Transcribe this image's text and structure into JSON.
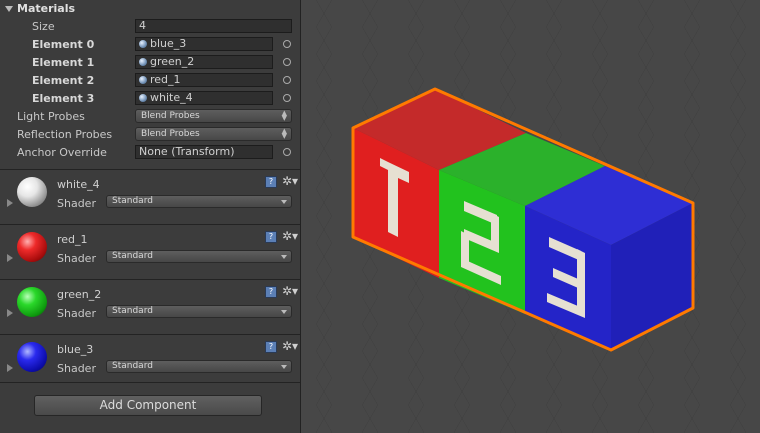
{
  "materials": {
    "header": "Materials",
    "size_label": "Size",
    "size_value": "4",
    "elements": [
      {
        "label": "Element 0",
        "value": "blue_3"
      },
      {
        "label": "Element 1",
        "value": "green_2"
      },
      {
        "label": "Element 2",
        "value": "red_1"
      },
      {
        "label": "Element 3",
        "value": "white_4"
      }
    ]
  },
  "renderer": {
    "light_probes_label": "Light Probes",
    "light_probes_value": "Blend Probes",
    "reflection_probes_label": "Reflection Probes",
    "reflection_probes_value": "Blend Probes",
    "anchor_override_label": "Anchor Override",
    "anchor_override_value": "None (Transform)"
  },
  "material_panels": [
    {
      "name": "white_4",
      "shader_label": "Shader",
      "shader": "Standard",
      "color": "#ffffff"
    },
    {
      "name": "red_1",
      "shader_label": "Shader",
      "shader": "Standard",
      "color": "#e82020"
    },
    {
      "name": "green_2",
      "shader_label": "Shader",
      "shader": "Standard",
      "color": "#22cc22"
    },
    {
      "name": "blue_3",
      "shader_label": "Shader",
      "shader": "Standard",
      "color": "#2222dd"
    }
  ],
  "add_component_label": "Add Component",
  "help_glyph": "?",
  "gear_glyph": "✲▾",
  "scene": {
    "object_face_numbers": [
      "1",
      "2",
      "3"
    ],
    "face_colors": {
      "red": "#e01f1f",
      "green": "#22c21e",
      "blue": "#2424c8"
    },
    "selection_outline_color": "#ff7a00"
  }
}
